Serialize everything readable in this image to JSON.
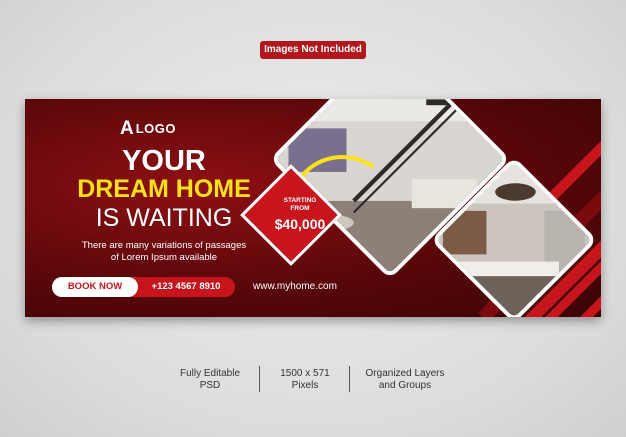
{
  "top_badge": "Images Not Included",
  "banner": {
    "logo_mark": "A",
    "logo_text": "LOGO",
    "headline_1": "YOUR",
    "headline_2": "DREAM HOME",
    "headline_3": "IS WAITING",
    "paragraph_line_1": "There are many variations of passages",
    "paragraph_line_2": "of Lorem Ipsum available",
    "cta_label": "BOOK NOW",
    "phone": "+123 4567 8910",
    "website": "www.myhome.com",
    "starting_line_1": "STARTING",
    "starting_line_2": "FROM",
    "price": "$40,000"
  },
  "features": [
    {
      "line1": "Fully Editable",
      "line2": "PSD"
    },
    {
      "line1": "1500 x 571",
      "line2": "Pixels"
    },
    {
      "line1": "Organized Layers",
      "line2": "and Groups"
    }
  ],
  "colors": {
    "accent_red": "#c8151c",
    "dark_red": "#5a0709",
    "headline_yellow": "#ffe11a",
    "text_white": "#ffffff"
  }
}
